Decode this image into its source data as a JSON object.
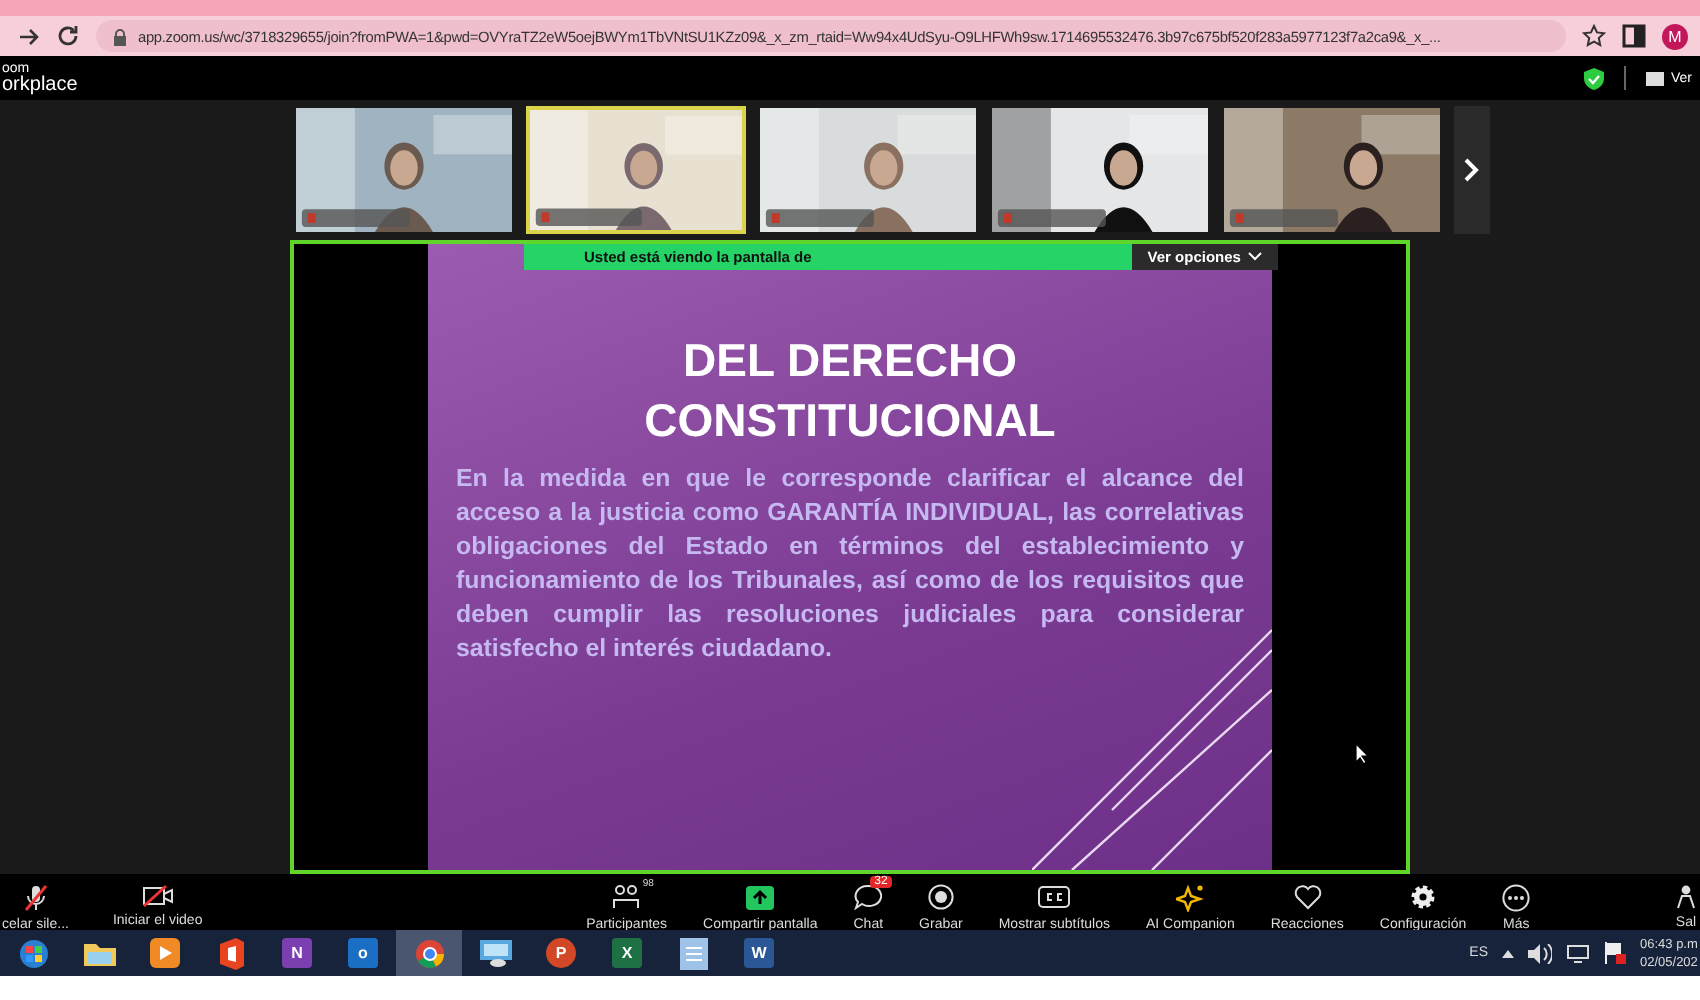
{
  "browser": {
    "url": "app.zoom.us/wc/3718329655/join?fromPWA=1&pwd=OVYraTZ2eW5oejBWYm1TbVNtSU1KZz09&_x_zm_rtaid=Ww94x4UdSyu-O9LHFWh9sw.1714695532476.3b97c675bf520f283a5977123f7a2ca9&_x_...",
    "profile": "M"
  },
  "header": {
    "logo_top": "oom",
    "logo_bottom": "orkplace",
    "view_button": "Ver"
  },
  "participants": [
    {
      "kind": "picture",
      "speaking": false
    },
    {
      "kind": "picture",
      "speaking": true
    },
    {
      "kind": "picture",
      "speaking": false
    },
    {
      "kind": "picture",
      "speaking": false
    },
    {
      "kind": "picture",
      "speaking": false
    }
  ],
  "share_banner": {
    "text": "Usted está viendo la pantalla de",
    "options_button": "Ver opciones"
  },
  "slide": {
    "title_lines": [
      "DEL DERECHO",
      "CONSTITUCIONAL"
    ],
    "body": "En la medida en que le corresponde clarificar el alcance del acceso a la justicia como GARANTÍA INDIVIDUAL, las correlativas obligaciones del Estado en términos del establecimiento y funcionamiento de los Tribunales, así como de los requisitos que deben cumplir las resoluciones judiciales para considerar satisfecho el interés ciudadano."
  },
  "toolbar": [
    {
      "kind": "mic",
      "label": "celar sile..."
    },
    {
      "kind": "video",
      "label": "Iniciar el video"
    },
    {
      "kind": "participants",
      "label": "Participantes",
      "count": "98"
    },
    {
      "kind": "share",
      "label": "Compartir pantalla"
    },
    {
      "kind": "chat",
      "label": "Chat",
      "badge": "32"
    },
    {
      "kind": "record",
      "label": "Grabar"
    },
    {
      "kind": "cc",
      "label": "Mostrar subtítulos"
    },
    {
      "kind": "ai",
      "label": "AI Companion"
    },
    {
      "kind": "heart",
      "label": "Reacciones"
    },
    {
      "kind": "gear",
      "label": "Configuración"
    },
    {
      "kind": "more",
      "label": "Más"
    },
    {
      "kind": "leave",
      "label": "Sal"
    }
  ],
  "taskbar": {
    "apps": [
      {
        "kind": "start",
        "active": false
      },
      {
        "kind": "folder",
        "active": false
      },
      {
        "kind": "player",
        "active": false
      },
      {
        "kind": "office",
        "active": false
      },
      {
        "kind": "tile",
        "label": "N",
        "color": "#7b3fb0",
        "active": false
      },
      {
        "kind": "tile",
        "label": "o",
        "color": "#1a6fc4",
        "active": false
      },
      {
        "kind": "chrome",
        "active": true
      },
      {
        "kind": "remote",
        "active": false
      },
      {
        "kind": "round",
        "label": "P",
        "color": "#d24726",
        "active": false
      },
      {
        "kind": "tile",
        "label": "X",
        "color": "#1e7145",
        "active": false
      },
      {
        "kind": "notepad",
        "active": false
      },
      {
        "kind": "tile",
        "label": "W",
        "color": "#2b5797",
        "active": false
      }
    ],
    "language": "ES",
    "time": "06:43 p.m",
    "date": "02/05/202"
  }
}
